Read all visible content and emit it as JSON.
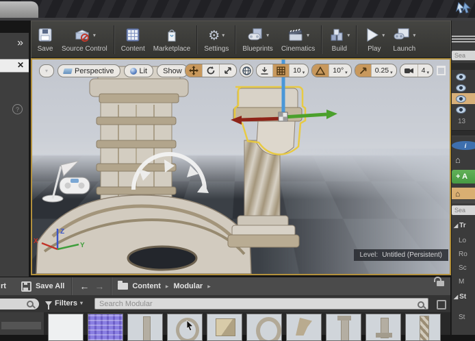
{
  "toolbar": {
    "items": [
      {
        "label": "Save",
        "dropdown": false
      },
      {
        "label": "Source Control",
        "dropdown": true
      },
      {
        "label": "Content",
        "dropdown": false
      },
      {
        "label": "Marketplace",
        "dropdown": false
      },
      {
        "label": "Settings",
        "dropdown": true
      },
      {
        "label": "Blueprints",
        "dropdown": true
      },
      {
        "label": "Cinematics",
        "dropdown": true
      },
      {
        "label": "Build",
        "dropdown": true
      },
      {
        "label": "Play",
        "dropdown": true
      },
      {
        "label": "Launch",
        "dropdown": true
      }
    ]
  },
  "viewport": {
    "view_mode_label": "Perspective",
    "lit_label": "Lit",
    "show_label": "Show",
    "snap": {
      "grid": "10",
      "rotation": "10°",
      "scale": "0.25",
      "camera_speed": "4"
    },
    "level_label": "Level:",
    "level_value": "Untitled (Persistent)",
    "axes": {
      "x": "X",
      "y": "Y",
      "z": "Z"
    }
  },
  "outliner": {
    "search_fragment": "Sea",
    "actor_count_fragment": "13"
  },
  "details": {
    "search_fragment": "Sea",
    "add_button_fragment": "+ A",
    "transform_section_fragment": "Tr",
    "property_fragments": [
      "Lo",
      "Ro",
      "Sc",
      "M"
    ],
    "static_mesh_section_fragment": "St",
    "static_mesh_property_fragment": "St"
  },
  "content_browser": {
    "import_button_fragment": "rt",
    "save_all_label": "Save All",
    "breadcrumb_root": "Content",
    "breadcrumb_folder": "Modular",
    "filters_label": "Filters",
    "search_placeholder": "Search Modular",
    "thumbnails": [
      "blank-texture",
      "normal-map-texture",
      "pillar-mesh",
      "arch-mesh",
      "crate-mesh",
      "ring-mesh",
      "bracket-mesh",
      "column-mesh",
      "pedestal-mesh",
      "twisted-column-mesh"
    ]
  },
  "icons": {
    "caret_down": "▾",
    "breadcrumb_arrow": "▸",
    "back_arrow": "←",
    "forward_arrow": "→",
    "close": "✕",
    "collapse_chevrons": "»",
    "help": "?",
    "section_arrow": "◢",
    "house": "⌂",
    "info": "i"
  }
}
